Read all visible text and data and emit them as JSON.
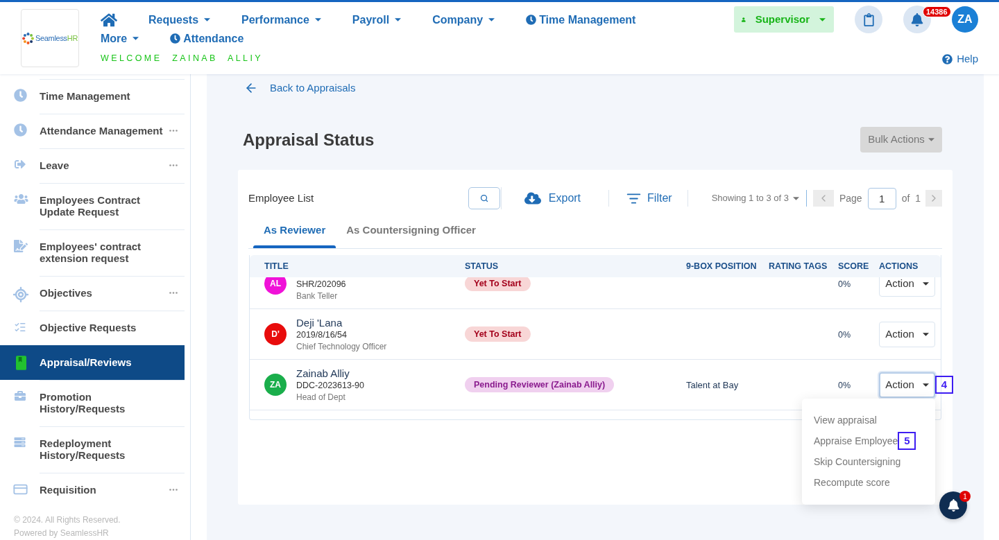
{
  "header": {
    "logo": {
      "name": "Seamless",
      "accent": "HR"
    },
    "nav_rows": [
      [
        {
          "kind": "home"
        },
        {
          "kind": "menu",
          "label": "Requests"
        },
        {
          "kind": "menu",
          "label": "Performance"
        },
        {
          "kind": "menu",
          "label": "Payroll"
        },
        {
          "kind": "menu",
          "label": "Company"
        },
        {
          "kind": "page",
          "label": "Time Management"
        }
      ],
      [
        {
          "kind": "menu",
          "label": "More"
        },
        {
          "kind": "page",
          "label": "Attendance"
        }
      ]
    ],
    "welcome": "WELCOME ZAINAB ALLIY",
    "role": "Supervisor",
    "notification_count": "14386",
    "user_initials": "ZA",
    "help": "Help"
  },
  "sidebar": {
    "items": [
      {
        "label": "Time Management",
        "has_menu": false,
        "selected": false
      },
      {
        "label": "Attendance Management",
        "has_menu": true,
        "selected": false
      },
      {
        "label": "Leave",
        "has_menu": true,
        "selected": false
      },
      {
        "label": "Employees Contract Update Request",
        "has_menu": false,
        "selected": false
      },
      {
        "label": "Employees' contract extension request",
        "has_menu": false,
        "selected": false
      },
      {
        "label": "Objectives",
        "has_menu": true,
        "selected": false
      },
      {
        "label": "Objective Requests",
        "has_menu": false,
        "selected": false
      },
      {
        "label": "Appraisal/Reviews",
        "has_menu": false,
        "selected": true
      },
      {
        "label": "Promotion History/Requests",
        "has_menu": false,
        "selected": false
      },
      {
        "label": "Redeployment History/Requests",
        "has_menu": false,
        "selected": false
      },
      {
        "label": "Requisition",
        "has_menu": true,
        "selected": false
      }
    ],
    "footer": [
      "© 2024. All Rights Reserved.",
      "Powered by SeamlessHR"
    ]
  },
  "page": {
    "back_link": "Back to Appraisals",
    "title": "Appraisal Status",
    "bulk_actions": "Bulk Actions",
    "panel": {
      "heading": "Employee List",
      "export": "Export",
      "filter": "Filter",
      "showing": "Showing 1 to 3 of 3",
      "page_label": "Page",
      "page_value": "1",
      "page_total": "of 1",
      "tabs": [
        {
          "label": "As Reviewer",
          "selected": true
        },
        {
          "label": "As Countersigning Officer",
          "selected": false
        }
      ],
      "table": {
        "columns": [
          "TITLE",
          "STATUS",
          "9-BOX POSITION",
          "RATING TAGS",
          "SCORE",
          "ACTIONS"
        ],
        "rows": [
          {
            "initials": "AL",
            "color": "#f012d8",
            "id": "SHR/202096",
            "job": "Bank Teller",
            "status": {
              "label": "Yet To Start",
              "kind": "not_started"
            },
            "score": "0%",
            "action": "Action",
            "action_open": false
          },
          {
            "initials": "D'",
            "color": "#e80c0c",
            "name": "Deji 'Lana",
            "id": "2019/8/16/54",
            "job": "Chief Technology Officer",
            "status": {
              "label": "Yet To Start",
              "kind": "not_started"
            },
            "score": "0%",
            "action": "Action",
            "action_open": false
          },
          {
            "initials": "ZA",
            "color": "#1aae4b",
            "name": "Zainab Alliy",
            "id": "DDC-2023613-90",
            "job": "Head of Dept",
            "status": {
              "label": "Pending Reviewer (Zainab Alliy)",
              "kind": "pending"
            },
            "nine_box": "Talent at Bay",
            "score": "0%",
            "action": "Action",
            "action_open": true,
            "marker": "4"
          }
        ]
      },
      "action_menu": [
        {
          "label": "View appraisal"
        },
        {
          "label": "Appraise Employee",
          "marker": "5"
        },
        {
          "label": "Skip Countersigning"
        },
        {
          "label": "Recompute score"
        }
      ]
    }
  },
  "chat_notifications": {
    "count": "1"
  }
}
